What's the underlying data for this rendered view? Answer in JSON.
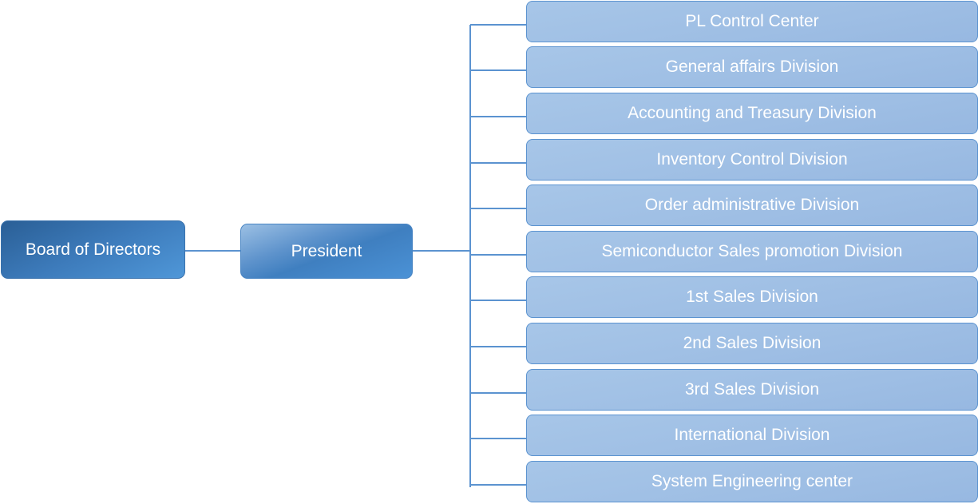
{
  "diagram": {
    "type": "org-chart",
    "root": {
      "label": "Board of Directors"
    },
    "president": {
      "label": "President"
    },
    "divisions": [
      {
        "label": "PL Control Center"
      },
      {
        "label": "General affairs Division"
      },
      {
        "label": "Accounting and Treasury Division"
      },
      {
        "label": "Inventory Control Division"
      },
      {
        "label": "Order administrative Division"
      },
      {
        "label": "Semiconductor Sales promotion Division"
      },
      {
        "label": "1st Sales Division"
      },
      {
        "label": "2nd Sales Division"
      },
      {
        "label": "3rd Sales Division"
      },
      {
        "label": "International Division"
      },
      {
        "label": "System Engineering center"
      }
    ],
    "colors": {
      "board_fill": "#3d7bbb",
      "president_fill": "#5e93cc",
      "division_fill": "#9ebee4",
      "connector": "#5b93d0",
      "text": "#ffffff"
    }
  }
}
